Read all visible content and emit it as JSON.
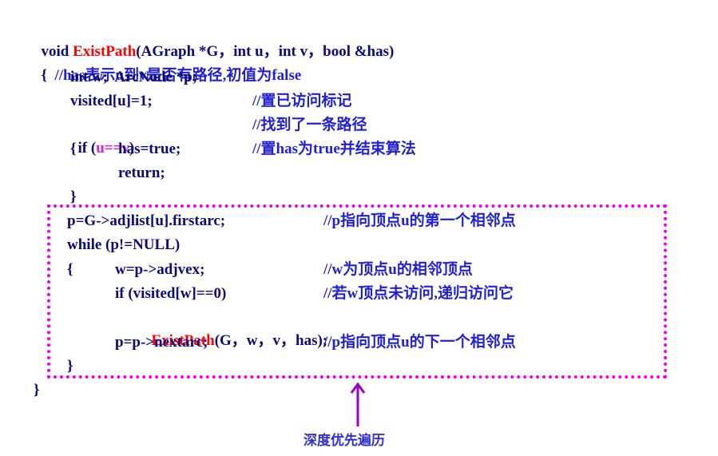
{
  "header": {
    "sig_prefix": "void ",
    "func_name": "ExistPath",
    "sig_rest": "(AGraph *G，int u，int v，bool &has)",
    "brace_open": "{  ",
    "header_comment": "//has表示u到v是否有路径,初值为false"
  },
  "body": {
    "decl": "int w;  ArcNode *p;",
    "visited": {
      "code": "visited[u]=1;",
      "comment": "//置已访问标记"
    },
    "if_line": {
      "prefix": "if (",
      "cond": "u==v",
      "suffix": ")",
      "comment": "//找到了一条路径"
    },
    "has_line": {
      "brace": "{",
      "code": "has=true;",
      "comment": "//置has为true并结束算法"
    },
    "return_line": "return;",
    "close_brace": "}"
  },
  "loop": {
    "p_init": {
      "code": "p=G->adjlist[u].firstarc;",
      "comment": "//p指向顶点u的第一个相邻点"
    },
    "while_line": "while (p!=NULL)",
    "w_line": {
      "brace": "{",
      "code": "w=p->adjvex;",
      "comment": "//w为顶点u的相邻顶点"
    },
    "if_visited": {
      "code": "if (visited[w]==0)",
      "comment": "//若w顶点未访问,递归访问它"
    },
    "recursive": {
      "func": "ExistPath",
      "args": "(G，w，v，has);"
    },
    "next": {
      "code": "p=p->nextarc;",
      "comment": "//p指向顶点u的下一个相邻点"
    },
    "close_brace": "}"
  },
  "end_brace": "}",
  "annotation": "深度优先遍历",
  "colors": {
    "code": "#0a0a7a",
    "comment": "#1f1fd6",
    "function_name": "#ff0000",
    "condition": "#e01ae0",
    "highlight_box": "#ee00ee",
    "arrow": "#9b00cc"
  }
}
